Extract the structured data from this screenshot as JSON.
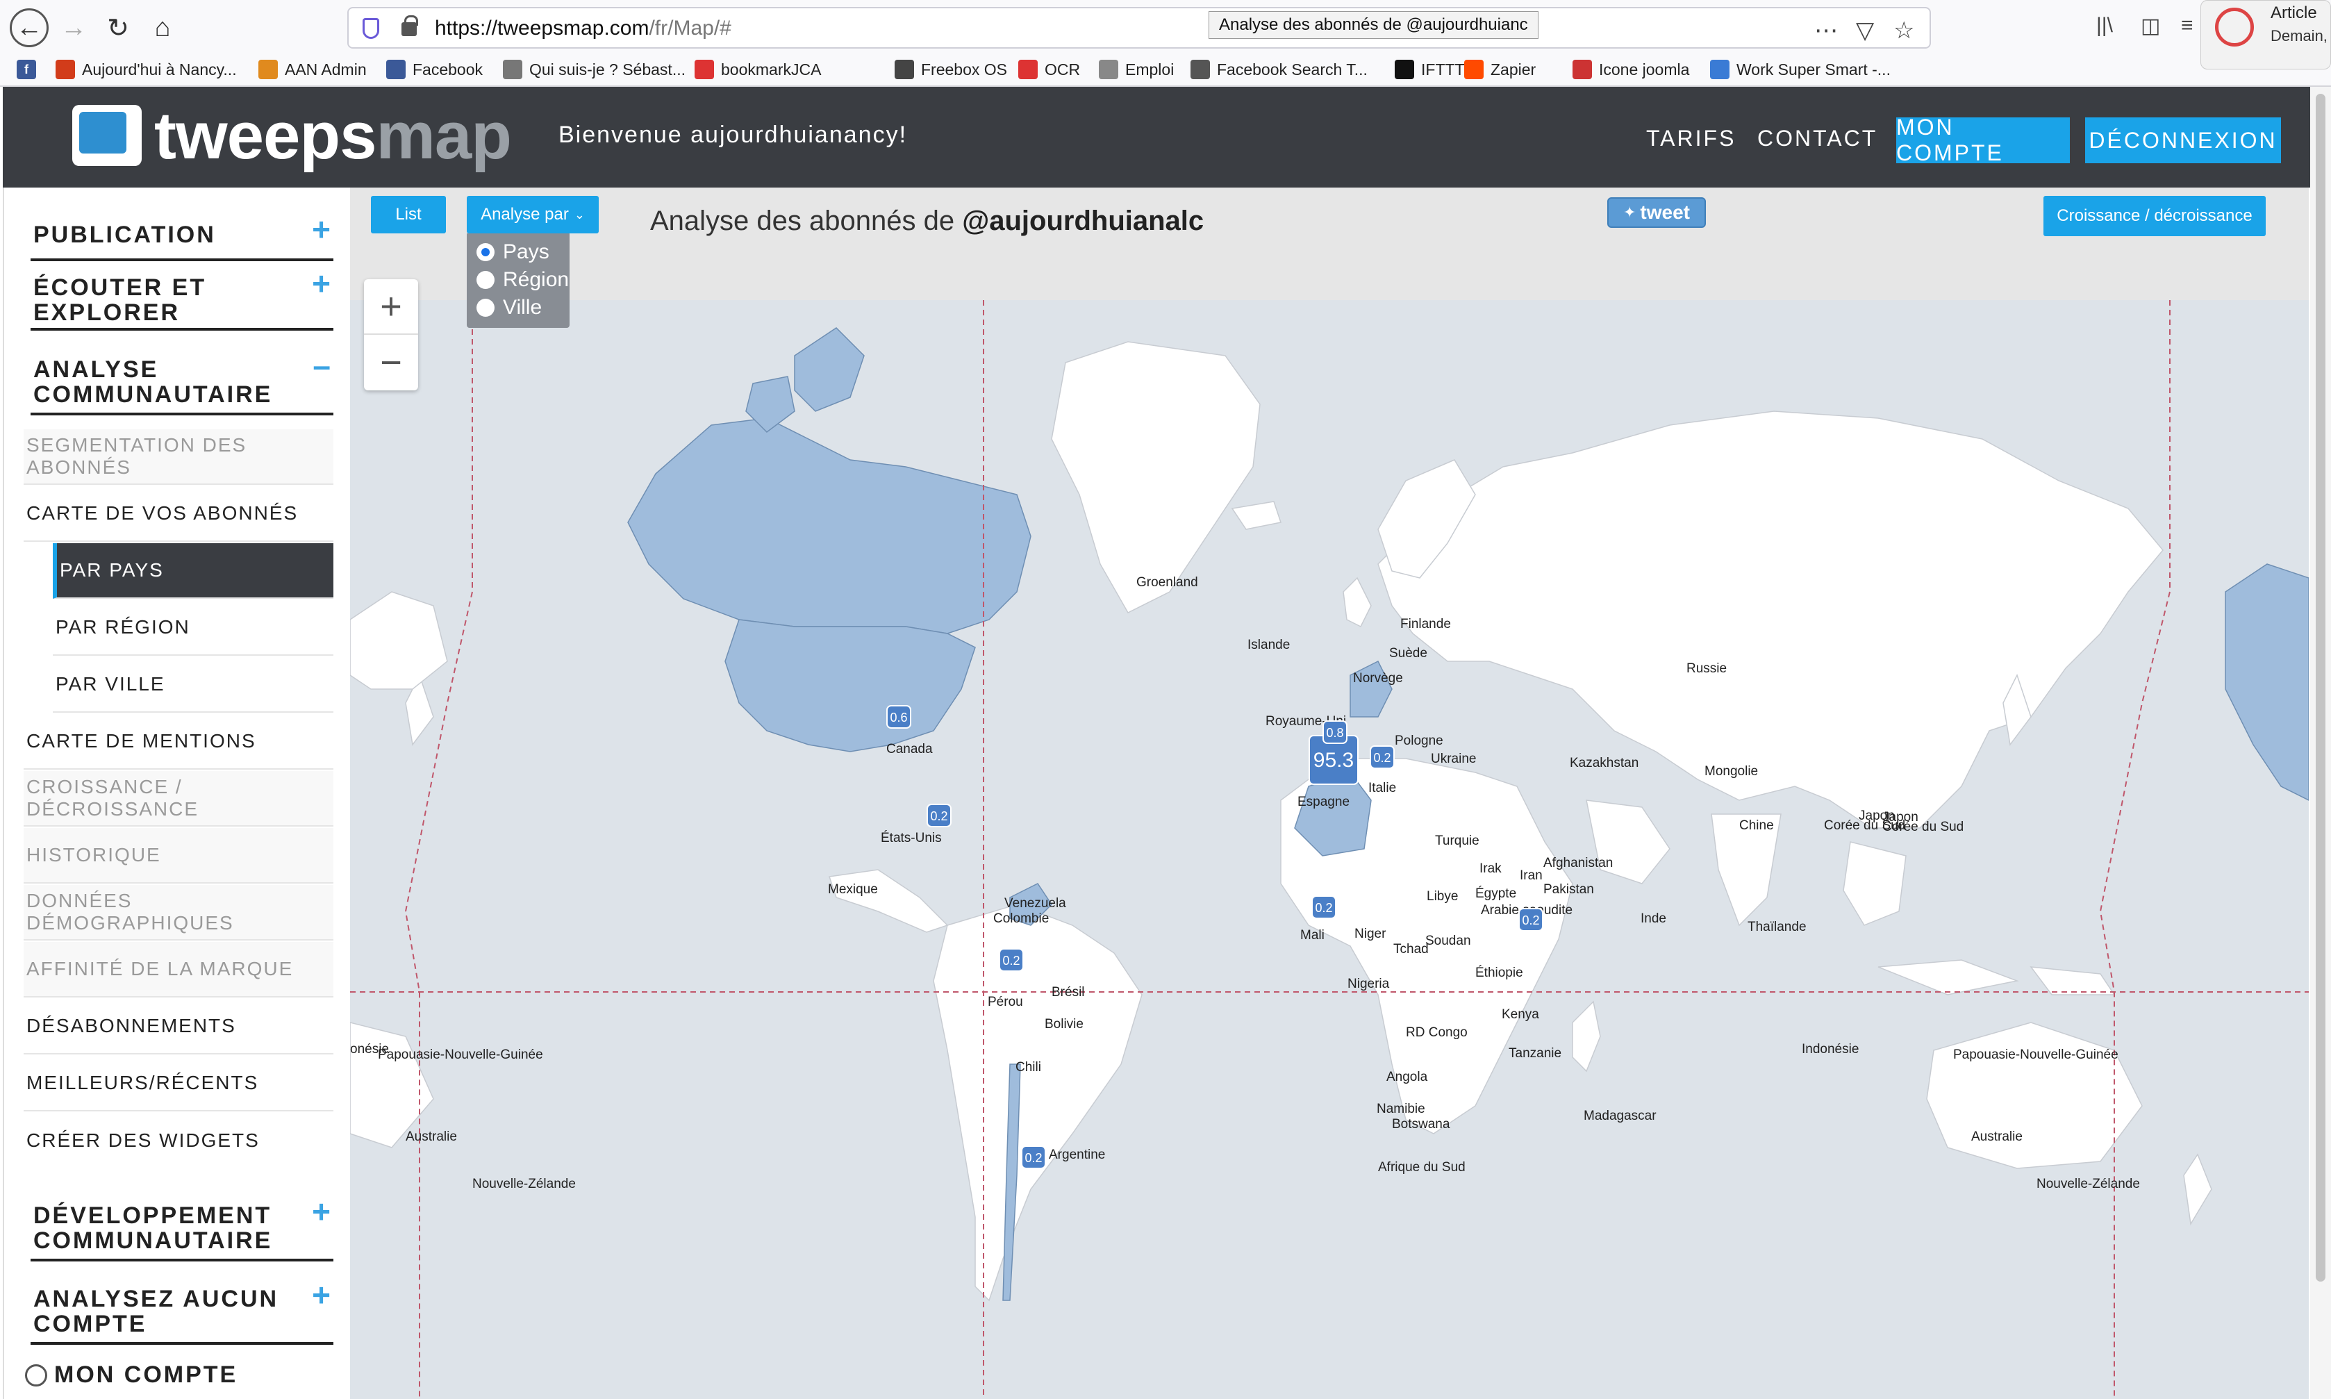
{
  "browser": {
    "url_host": "https://tweepsmap.com",
    "url_path": "/fr/Map/#",
    "tooltip": "Analyse des abonnés de @aujourdhuianc",
    "bookmarks": [
      {
        "label": "Aujourd'hui à Nancy...",
        "color": "#d23c1a"
      },
      {
        "label": "AAN Admin",
        "color": "#e08a1e"
      },
      {
        "label": "Facebook",
        "color": "#3b5998"
      },
      {
        "label": "Qui suis-je ? Sébast...",
        "color": "#777777"
      },
      {
        "label": "bookmarkJCA",
        "color": "#d33"
      },
      {
        "label": "Freebox OS",
        "color": "#444444"
      },
      {
        "label": "OCR",
        "color": "#d33"
      },
      {
        "label": "Emploi",
        "color": "#888888"
      },
      {
        "label": "Facebook Search T...",
        "color": "#555555"
      },
      {
        "label": "IFTTT",
        "color": "#111111"
      },
      {
        "label": "Zapier",
        "color": "#ff4a00"
      },
      {
        "label": "Icone joomla",
        "color": "#c33"
      },
      {
        "label": "Work Super Smart -...",
        "color": "#3a7bd5"
      }
    ],
    "notification": {
      "title": "Article",
      "subtitle": "Demain,"
    }
  },
  "header": {
    "logo_a": "tweeps",
    "logo_b": "map",
    "welcome": "Bienvenue aujourdhuianancy!",
    "nav_tarifs": "TARIFS",
    "nav_contact": "CONTACT",
    "btn_compte": "MON COMPTE",
    "btn_deconnexion": "DÉCONNEXION"
  },
  "sidebar": {
    "publication": "PUBLICATION",
    "ecouter_1": "ÉCOUTER ET",
    "ecouter_2": "EXPLORER",
    "analyse_1": "ANALYSE",
    "analyse_2": "COMMUNAUTAIRE",
    "items": [
      "SEGMENTATION DES ABONNÉS",
      "CARTE DE VOS ABONNÉS",
      "PAR PAYS",
      "PAR RÉGION",
      "PAR VILLE",
      "CARTE DE MENTIONS",
      "CROISSANCE / DÉCROISSANCE",
      "HISTORIQUE",
      "DONNÉES DÉMOGRAPHIQUES",
      "AFFINITÉ DE LA MARQUE",
      "DÉSABONNEMENTS",
      "MEILLEURS/RÉCENTS",
      "CRÉER DES WIDGETS"
    ],
    "dev_1": "DÉVELOPPEMENT",
    "dev_2": "COMMUNAUTAIRE",
    "aucun_1": "ANALYSEZ AUCUN",
    "aucun_2": "COMPTE",
    "mon_compte": "MON COMPTE"
  },
  "map": {
    "list_btn": "List",
    "analyse_btn": "Analyse par",
    "radios": [
      {
        "label": "Pays",
        "selected": true
      },
      {
        "label": "Région",
        "selected": false
      },
      {
        "label": "Ville",
        "selected": false
      }
    ],
    "title_prefix": "Analyse des abonnés de ",
    "title_handle": "@aujourdhuianalc",
    "tweet": "tweet",
    "croissance_btn": "Croissance / décroissance",
    "zoom_in": "+",
    "zoom_out": "−",
    "labels": [
      "Groenland",
      "Islande",
      "Finlande",
      "Suède",
      "Norvège",
      "Russie",
      "Royaume-Uni",
      "Pologne",
      "Ukraine",
      "Kazakhstan",
      "Mongolie",
      "Chine",
      "Japon",
      "Corée du Sud",
      "Italie",
      "Espagne",
      "Turquie",
      "Irak",
      "Iran",
      "Afghanistan",
      "Pakistan",
      "Inde",
      "Thaïlande",
      "Libye",
      "Égypte",
      "Arabie saoudite",
      "Mali",
      "Niger",
      "Tchad",
      "Soudan",
      "Éthiopie",
      "Nigeria",
      "Kenya",
      "RD Congo",
      "Tanzanie",
      "Angola",
      "Namibie",
      "Botswana",
      "Madagascar",
      "Afrique du Sud",
      "Canada",
      "États-Unis",
      "Mexique",
      "Venezuela",
      "Colombie",
      "Pérou",
      "Brésil",
      "Bolivie",
      "Chili",
      "Argentine",
      "Papouasie-Nouvelle-Guinée",
      "Indonésie",
      "Australie",
      "Nouvelle-Zélande",
      "Japon",
      "Corée du Sud",
      "onésie",
      "Papouasie-Nouvelle-Guinée",
      "Australie",
      "Nouvelle-Zélande"
    ],
    "markers": [
      {
        "value": "0.6",
        "big": false
      },
      {
        "value": "0.2",
        "big": false
      },
      {
        "value": "95.3",
        "big": true
      },
      {
        "value": "0.8",
        "big": false
      },
      {
        "value": "0.2",
        "big": false
      },
      {
        "value": "0.2",
        "big": false
      },
      {
        "value": "0.2",
        "big": false
      },
      {
        "value": "0.2",
        "big": false
      },
      {
        "value": "0.2",
        "big": false
      }
    ],
    "colors": {
      "highlight": "#9fbcdc",
      "land": "#ffffff",
      "water": "#dde3e9",
      "marker": "#4a7fc7"
    }
  }
}
